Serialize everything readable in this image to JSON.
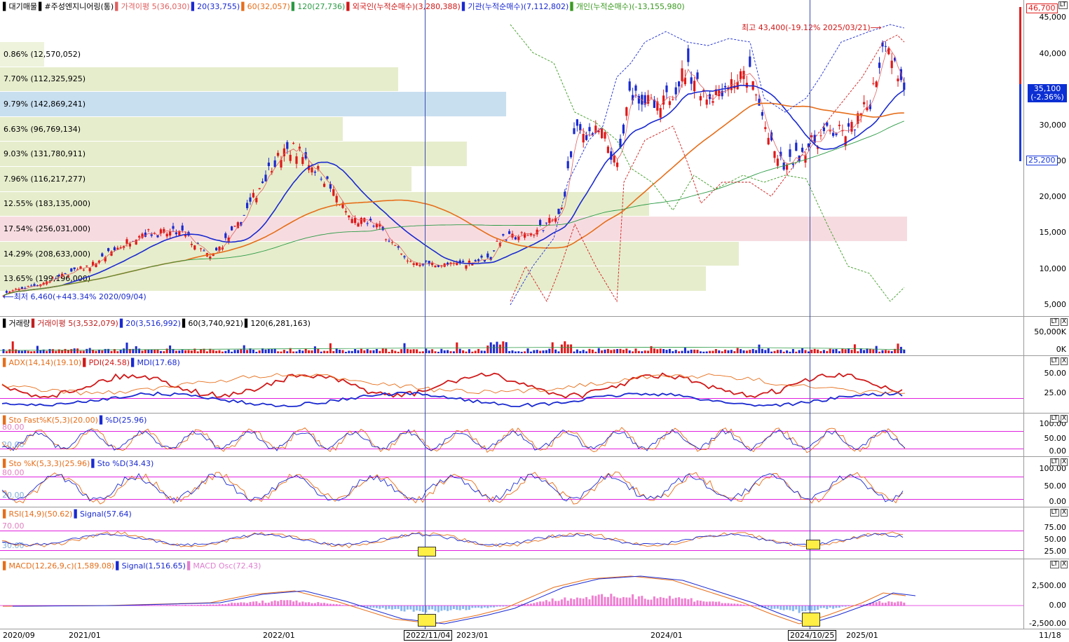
{
  "app": {
    "stock_name": "#주성엔지니어링(통)",
    "daily_label": "대기매물"
  },
  "main": {
    "legend": [
      {
        "text": "대기매물",
        "color": "#000000"
      },
      {
        "text": "#주성엔지니어링(통)",
        "color": "#000000"
      },
      {
        "text": "가격이평 5(36,030)",
        "color": "#e06060"
      },
      {
        "text": "20(33,755)",
        "color": "#1a2ad0"
      },
      {
        "text": "60(32,057)",
        "color": "#e66e1a"
      },
      {
        "text": "120(27,736)",
        "color": "#2a9a44"
      },
      {
        "text": "외국인(누적순매수)(3,280,388)",
        "color": "#d01818"
      },
      {
        "text": "기관(누적순매수)(7,112,802)",
        "color": "#1a2ad0"
      },
      {
        "text": "개인(누적순매수)(-13,155,980)",
        "color": "#3a9a20"
      }
    ],
    "price_ticks": [
      "45,000",
      "40,000",
      "35,000",
      "30,000",
      "25,000",
      "20,000",
      "15,000",
      "10,000",
      "5,000"
    ],
    "profile": [
      {
        "label": "0.86% (12,570,052)",
        "pct": 0.86,
        "color": "#eef3dc"
      },
      {
        "label": "7.70% (112,325,925)",
        "pct": 7.7,
        "color": "#e6edcc"
      },
      {
        "label": "9.79% (142,869,241)",
        "pct": 9.79,
        "color": "#c8dff0"
      },
      {
        "label": "6.63% (96,769,134)",
        "pct": 6.63,
        "color": "#e6edcc"
      },
      {
        "label": "9.03% (131,780,911)",
        "pct": 9.03,
        "color": "#e6edcc"
      },
      {
        "label": "7.96% (116,217,277)",
        "pct": 7.96,
        "color": "#e6edcc"
      },
      {
        "label": "12.55% (183,135,000)",
        "pct": 12.55,
        "color": "#e6edcc"
      },
      {
        "label": "17.54% (256,031,000)",
        "pct": 17.54,
        "color": "#f6dce0"
      },
      {
        "label": "14.29% (208,633,000)",
        "pct": 14.29,
        "color": "#e6edcc"
      },
      {
        "label": "13.65% (199,196,000)",
        "pct": 13.65,
        "color": "#e6edcc"
      }
    ],
    "high_label": "최고 43,400(-19.12% 2025/03/21)⟶",
    "low_label": "⟵최저 6,460(+443.34% 2020/09/04)",
    "current_price": "35,100",
    "current_change": "(-2.36%)",
    "top_box": "46,700",
    "bottom_box": "25,200",
    "price_range": [
      4000,
      46700
    ]
  },
  "volume": {
    "legend": [
      {
        "text": "거래량",
        "color": "#000000"
      },
      {
        "text": "거래이평 5(3,532,079)",
        "color": "#c02020"
      },
      {
        "text": "20(3,516,992)",
        "color": "#1a2ad0"
      },
      {
        "text": "60(3,740,921)",
        "color": "#000000"
      },
      {
        "text": "120(6,281,163)",
        "color": "#000000"
      }
    ],
    "ticks": [
      "50,000K",
      "0K"
    ]
  },
  "adx": {
    "legend": [
      {
        "text": "ADX(14,14)(19.10)",
        "color": "#e66e1a"
      },
      {
        "text": "PDI(24.58)",
        "color": "#d01818"
      },
      {
        "text": "MDI(17.68)",
        "color": "#1a2ad0"
      }
    ],
    "ticks": [
      "50.00",
      "25.00"
    ]
  },
  "stofast": {
    "legend": [
      {
        "text": "Sto Fast%K(5,3)(20.00)",
        "color": "#e66e1a"
      },
      {
        "text": "%D(25.96)",
        "color": "#1a2ad0"
      }
    ],
    "ticks": [
      "100.00",
      "50.00",
      "0.00"
    ],
    "level_hi": "80.00",
    "level_lo": "20.00"
  },
  "stoslow": {
    "legend": [
      {
        "text": "Sto %K(5,3,3)(25.96)",
        "color": "#e66e1a"
      },
      {
        "text": "Sto %D(34.43)",
        "color": "#1a2ad0"
      }
    ],
    "ticks": [
      "100.00",
      "50.00",
      "0.00"
    ],
    "level_hi": "80.00",
    "level_lo": "20.00"
  },
  "rsi": {
    "legend": [
      {
        "text": "RSI(14,9)(50.62)",
        "color": "#e66e1a"
      },
      {
        "text": "Signal(57.64)",
        "color": "#1a2ad0"
      }
    ],
    "ticks": [
      "75.00",
      "50.00",
      "25.00"
    ],
    "level_hi": "70.00",
    "level_lo": "30.00"
  },
  "macd": {
    "legend": [
      {
        "text": "MACD(12,26,9,c)(1,589.08)",
        "color": "#e66e1a"
      },
      {
        "text": "Signal(1,516.65)",
        "color": "#1a2ad0"
      },
      {
        "text": "MACD Osc(72.43)",
        "color": "#e080d0"
      }
    ],
    "ticks": [
      "2,500.00",
      "0.00",
      "-2,500.00"
    ]
  },
  "xaxis": {
    "labels": [
      "2020/09",
      "2021/01",
      "2022/01",
      "2022/11/04",
      "2023/01",
      "2024/01",
      "2024/10/25",
      "2025/01",
      "11/18"
    ],
    "selected": [
      "2022/11/04",
      "2024/10/25"
    ]
  },
  "controls": {
    "pane_buttons": [
      "LT",
      "X"
    ]
  }
}
